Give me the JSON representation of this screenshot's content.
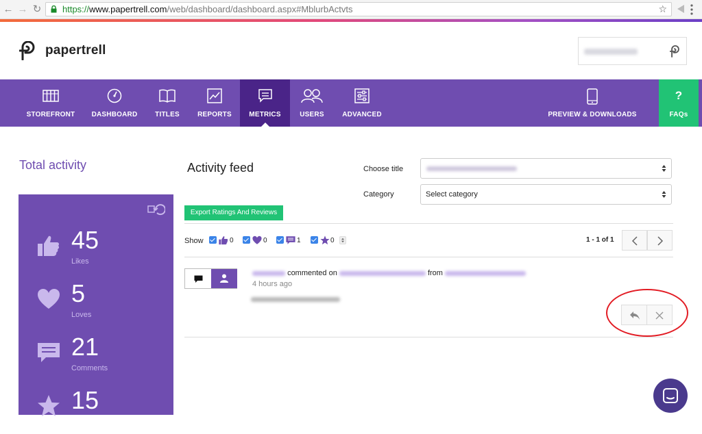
{
  "browser": {
    "url_protocol": "https://",
    "url_host": "www.papertrell.com",
    "url_path": "/web/dashboard/dashboard.aspx#MblurbActvts"
  },
  "header": {
    "logo_text": "papertrell"
  },
  "nav": {
    "items": [
      {
        "label": "STOREFRONT",
        "icon": "storefront-icon"
      },
      {
        "label": "DASHBOARD",
        "icon": "dashboard-gauge-icon"
      },
      {
        "label": "TITLES",
        "icon": "book-icon"
      },
      {
        "label": "REPORTS",
        "icon": "chart-icon"
      },
      {
        "label": "METRICS",
        "icon": "comment-icon",
        "active": true
      },
      {
        "label": "USERS",
        "icon": "users-icon"
      },
      {
        "label": "ADVANCED",
        "icon": "sliders-icon"
      }
    ],
    "preview_label": "PREVIEW & DOWNLOADS",
    "faq_symbol": "?",
    "faq_label": "FAQs"
  },
  "left": {
    "title": "Total activity",
    "stats": [
      {
        "value": "45",
        "label": "Likes",
        "icon": "thumbs-up-icon"
      },
      {
        "value": "5",
        "label": "Loves",
        "icon": "heart-icon"
      },
      {
        "value": "21",
        "label": "Comments",
        "icon": "comment-icon"
      },
      {
        "value": "15",
        "label": "",
        "icon": "star-icon"
      }
    ]
  },
  "feed": {
    "title": "Activity feed",
    "choose_title_label": "Choose title",
    "category_label": "Category",
    "category_value": "Select category",
    "export_label": "Export Ratings And Reviews",
    "show_label": "Show",
    "filters": [
      {
        "icon": "thumbs-up-icon",
        "count": "0",
        "checked": true
      },
      {
        "icon": "heart-icon",
        "count": "0",
        "checked": true
      },
      {
        "icon": "comment-icon",
        "count": "1",
        "checked": true
      },
      {
        "icon": "star-icon",
        "count": "0",
        "checked": true
      }
    ],
    "pager_text": "1 - 1 of 1",
    "item": {
      "commented_on": "commented on",
      "from": "from",
      "time": "4 hours ago"
    }
  },
  "colors": {
    "brand": "#6f4db0",
    "nav_active": "#4a2488",
    "green": "#21c375",
    "annotation": "#e21c24"
  }
}
